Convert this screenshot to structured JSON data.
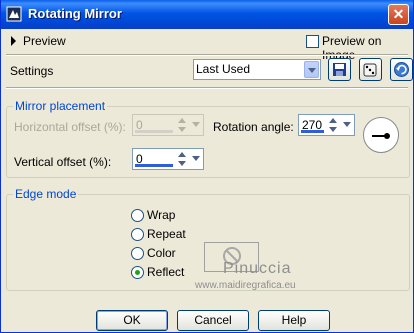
{
  "window": {
    "title": "Rotating Mirror"
  },
  "preview": {
    "label": "Preview",
    "preview_on_image_label": "Preview on Image",
    "preview_on_image_checked": false
  },
  "settings": {
    "label": "Settings",
    "preset_value": "Last Used",
    "icons": [
      "save-preset-icon",
      "random-dice-icon",
      "reset-icon"
    ]
  },
  "mirror_placement": {
    "title": "Mirror placement",
    "horizontal_offset_label": "Horizontal offset (%):",
    "horizontal_offset_value": "0",
    "horizontal_offset_enabled": false,
    "rotation_angle_label": "Rotation angle:",
    "rotation_angle_value": "270",
    "vertical_offset_label": "Vertical offset (%):",
    "vertical_offset_value": "0"
  },
  "edge_mode": {
    "title": "Edge mode",
    "options": [
      "Wrap",
      "Repeat",
      "Color",
      "Reflect"
    ],
    "selected": "Reflect"
  },
  "watermark": {
    "line1": "Pinuccia",
    "line2": "www.maidiregrafica.eu"
  },
  "buttons": {
    "ok": "OK",
    "cancel": "Cancel",
    "help": "Help"
  },
  "colors": {
    "title_bar": "#0055E5",
    "window_bg": "#ECE9D8",
    "group_title": "#0046D5",
    "selected_radio": "#21A121"
  }
}
